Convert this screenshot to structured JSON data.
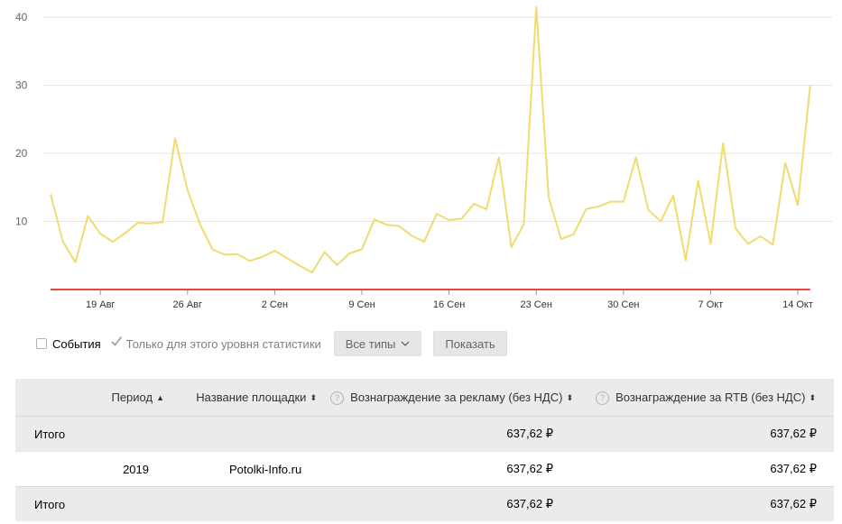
{
  "chart_data": {
    "type": "line",
    "y_ticks": [
      "10",
      "20",
      "30",
      "40"
    ],
    "ylim": [
      0,
      42
    ],
    "x_tick_labels": [
      "19 Авг",
      "26 Авг",
      "2 Сен",
      "9 Сен",
      "16 Сен",
      "23 Сен",
      "30 Сен",
      "7 Окт",
      "14 Окт"
    ],
    "x": [
      "15 Авг",
      "16 Авг",
      "17 Авг",
      "18 Авг",
      "19 Авг",
      "20 Авг",
      "21 Авг",
      "22 Авг",
      "23 Авг",
      "24 Авг",
      "25 Авг",
      "26 Авг",
      "27 Авг",
      "28 Авг",
      "29 Авг",
      "30 Авг",
      "31 Авг",
      "1 Сен",
      "2 Сен",
      "3 Сен",
      "4 Сен",
      "5 Сен",
      "6 Сен",
      "7 Сен",
      "8 Сен",
      "9 Сен",
      "10 Сен",
      "11 Сен",
      "12 Сен",
      "13 Сен",
      "14 Сен",
      "15 Сен",
      "16 Сен",
      "17 Сен",
      "18 Сен",
      "19 Сен",
      "20 Сен",
      "21 Сен",
      "22 Сен",
      "23 Сен",
      "24 Сен",
      "25 Сен",
      "26 Сен",
      "27 Сен",
      "28 Сен",
      "29 Сен",
      "30 Сен",
      "1 Окт",
      "2 Окт",
      "3 Окт",
      "4 Окт",
      "5 Окт",
      "6 Окт",
      "7 Окт",
      "8 Окт",
      "9 Окт",
      "10 Окт",
      "11 Окт",
      "12 Окт",
      "13 Окт",
      "14 Окт",
      "15 Окт",
      "16 Окт"
    ],
    "series": [
      {
        "color": "#f0dc6e",
        "values": [
          14,
          7,
          4,
          10.8,
          8.2,
          7,
          8.3,
          9.8,
          9.7,
          9.9,
          22.2,
          14.6,
          9.6,
          5.9,
          5.1,
          5.2,
          4.2,
          4.8,
          5.7,
          4.6,
          3.5,
          2.5,
          5.5,
          3.6,
          5.3,
          5.9,
          10.3,
          9.5,
          9.3,
          7.9,
          7,
          11.1,
          10.2,
          10.4,
          12.6,
          11.8,
          19.4,
          6.2,
          9.6,
          41.5,
          13.5,
          7.4,
          8.1,
          11.8,
          12.2,
          12.9,
          12.9,
          19.4,
          11.7,
          10,
          13.8,
          4.3,
          16,
          6.7,
          21.5,
          9,
          6.7,
          7.8,
          6.6,
          18.6,
          12.4,
          30
        ]
      },
      {
        "color": "#e8453c",
        "values": [
          0,
          0,
          0,
          0,
          0,
          0,
          0,
          0,
          0,
          0,
          0,
          0,
          0,
          0,
          0,
          0,
          0,
          0,
          0,
          0,
          0,
          0,
          0,
          0,
          0,
          0,
          0,
          0,
          0,
          0,
          0,
          0,
          0,
          0,
          0,
          0,
          0,
          0,
          0,
          0,
          0,
          0,
          0,
          0,
          0,
          0,
          0,
          0,
          0,
          0,
          0,
          0,
          0,
          0,
          0,
          0,
          0,
          0,
          0,
          0,
          0,
          0
        ]
      }
    ]
  },
  "controls": {
    "events_label": "События",
    "level_only_label": "Только для этого уровня статистики",
    "types_label": "Все типы",
    "show_label": "Показать"
  },
  "table": {
    "headers": {
      "period": "Период",
      "site": "Название площадки",
      "reward_ads": "Вознаграждение за рекламу (без НДС)",
      "reward_rtb": "Вознаграждение за RTB (без НДС)"
    },
    "total_top": {
      "label": "Итого",
      "reward_ads": "637,62 ₽",
      "reward_rtb": "637,62 ₽"
    },
    "rows": [
      {
        "period": "2019",
        "site": "Potolki-Info.ru",
        "reward_ads": "637,62 ₽",
        "reward_rtb": "637,62 ₽"
      }
    ],
    "total_bottom": {
      "label": "Итого",
      "reward_ads": "637,62 ₽",
      "reward_rtb": "637,62 ₽"
    }
  }
}
